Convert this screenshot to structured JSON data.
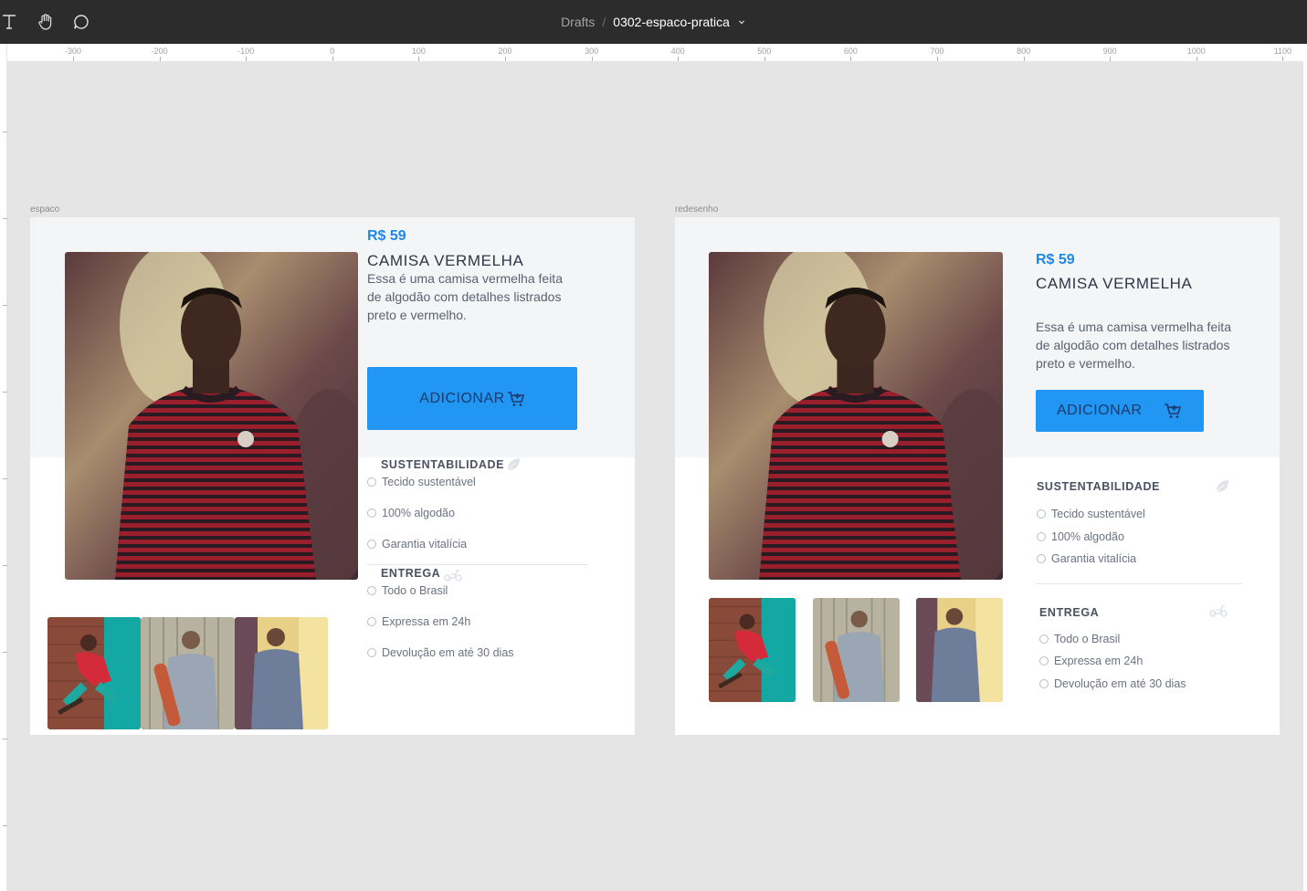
{
  "toolbar": {
    "breadcrumb_root": "Drafts",
    "separator": "/",
    "file_name": "0302-espaco-pratica",
    "icons": [
      "text-tool-icon",
      "hand-tool-icon",
      "comment-tool-icon",
      "chevron-down-icon"
    ]
  },
  "ruler": {
    "labels": [
      "-300",
      "-200",
      "-100",
      "0",
      "100",
      "200",
      "300",
      "400",
      "500",
      "600",
      "700",
      "800",
      "900",
      "1000",
      "1100"
    ]
  },
  "frames": {
    "left": {
      "label": "espaco",
      "price": "R$ 59",
      "name": "CAMISA VERMELHA",
      "description": "Essa é uma camisa vermelha feita de algodão com detalhes listrados preto e vermelho.",
      "button_label": "ADICIONAR",
      "sustainability_title": "SUSTENTABILIDADE",
      "sustainability_items": [
        "Tecido sustentável",
        "100% algodão",
        "Garantia vitalícia"
      ],
      "delivery_title": "ENTREGA",
      "delivery_items": [
        "Todo o Brasil",
        "Expressa em 24h",
        "Devolução em até 30 dias"
      ]
    },
    "right": {
      "label": "redesenho",
      "price": "R$ 59",
      "name": "CAMISA VERMELHA",
      "description": "Essa é uma camisa vermelha feita de algodão com detalhes listrados preto e vermelho.",
      "button_label": "ADICIONAR",
      "sustainability_title": "SUSTENTABILIDADE",
      "sustainability_items": [
        "Tecido sustentável",
        "100% algodão",
        "Garantia vitalícia"
      ],
      "delivery_title": "ENTREGA",
      "delivery_items": [
        "Todo o Brasil",
        "Expressa em 24h",
        "Devolução em até 30 dias"
      ]
    }
  },
  "colors": {
    "toolbar_bg": "#2c2c2c",
    "canvas_bg": "#e5e5e5",
    "accent_blue": "#2196f3",
    "price_blue": "#1e88e5",
    "band_gray": "#f4f5f7"
  }
}
